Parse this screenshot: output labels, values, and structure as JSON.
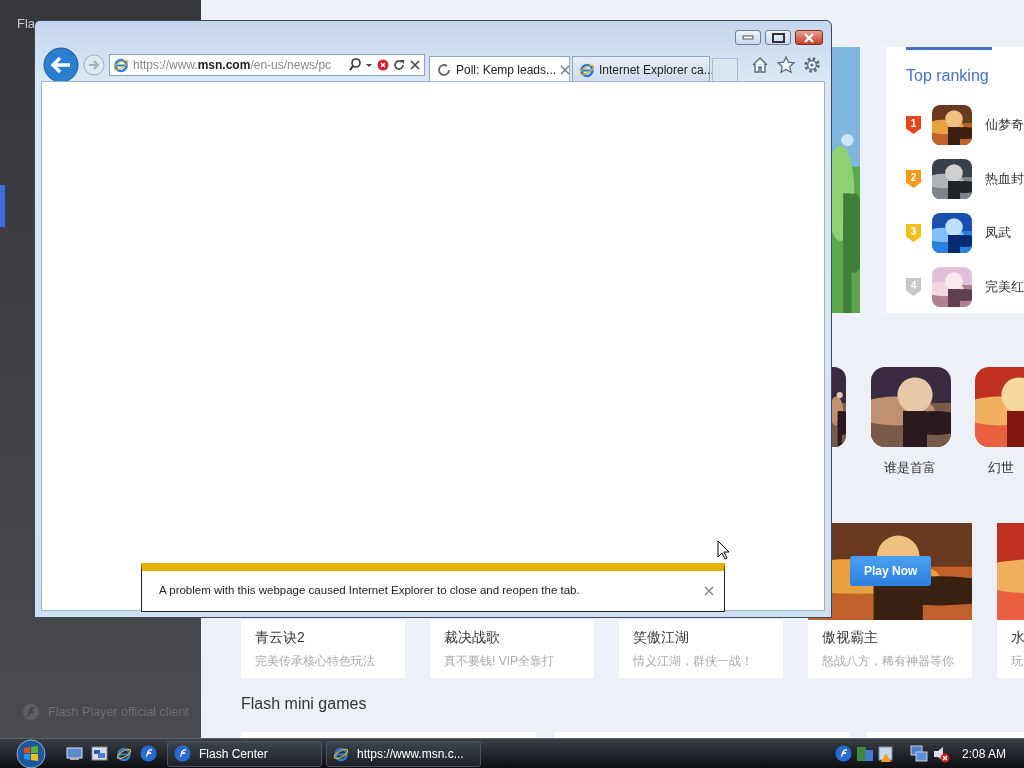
{
  "flash_center": {
    "title": "Fla",
    "footer": "Flash Player official client",
    "top_ranking": {
      "title": "Top ranking",
      "items": [
        {
          "rank": "1",
          "name": "仙梦奇",
          "color": "#e8441e"
        },
        {
          "rank": "2",
          "name": "热血封",
          "color": "#f39a1c"
        },
        {
          "rank": "3",
          "name": "凤武",
          "color": "#f2c01a"
        },
        {
          "rank": "4",
          "name": "完美红",
          "color": "#c8c8c8"
        }
      ]
    },
    "games": [
      {
        "name": "谁是首富"
      },
      {
        "name": "幻世"
      }
    ],
    "cards": [
      {
        "title": "青云诀2",
        "subtitle": "完美传承核心特色玩法"
      },
      {
        "title": "裁决战歌",
        "subtitle": "真不要钱! VIP全靠打"
      },
      {
        "title": "笑傲江湖",
        "subtitle": "情义江湖，群侠一战！"
      },
      {
        "title": "傲视霸主",
        "subtitle": "怒战八方，稀有神器等你",
        "kind": "picture",
        "button": "Play Now"
      },
      {
        "title": "水",
        "subtitle": "玩",
        "kind": "picture"
      }
    ],
    "section_heading": "Flash mini games"
  },
  "ie_window": {
    "address": "https://www.**msn.com**/en-us/news/pc",
    "tabs": [
      {
        "label": "Poll: Kemp leads...",
        "selected": true,
        "kind": "loading"
      },
      {
        "label": "Internet Explorer ca...",
        "selected": false,
        "kind": "page"
      }
    ],
    "notification": "A problem with this webpage caused Internet Explorer to close and reopen the tab."
  },
  "taskbar": {
    "tasks": [
      {
        "label": "Flash Center",
        "kind": "flash"
      },
      {
        "label": "https://www.msn.c...",
        "kind": "browser"
      }
    ],
    "clock": "2:08 AM"
  }
}
